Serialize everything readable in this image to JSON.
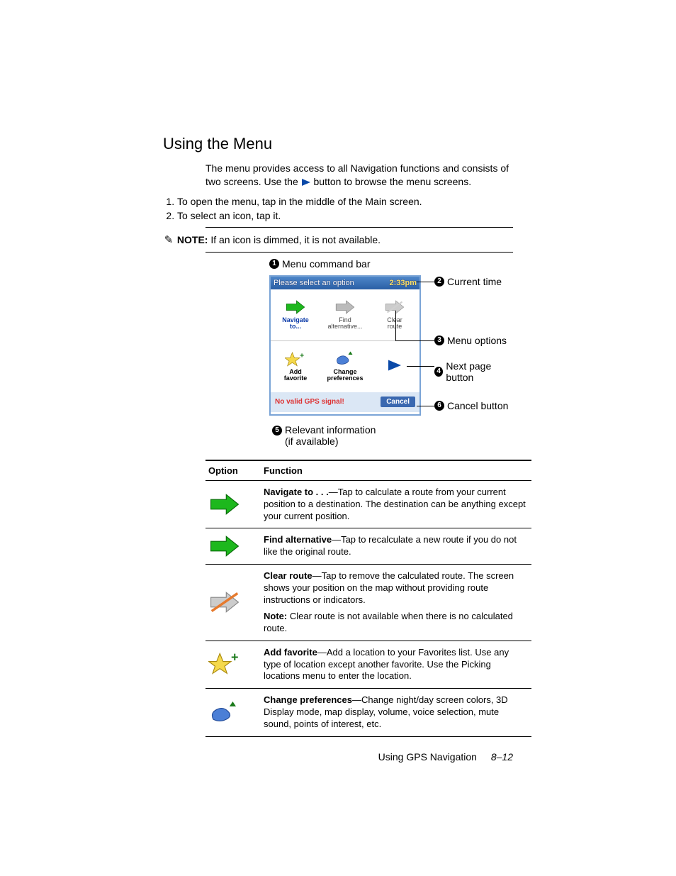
{
  "heading": "Using the Menu",
  "intro_a": "The menu provides access to all Navigation functions and consists of two screens. Use the ",
  "intro_b": " button to browse the menu screens.",
  "steps": [
    "To open the menu, tap in the middle of the Main screen.",
    "To select an icon, tap it."
  ],
  "note_label": "NOTE:",
  "note_text": " If an icon is dimmed, it is not available.",
  "screenshot": {
    "title": "Please select an option",
    "time": "2:33pm",
    "icons": {
      "navigate_to": "Navigate\nto...",
      "find_alt": "Find\nalternative...",
      "clear_route": "Clear\nroute",
      "add_fav": "Add\nfavorite",
      "change_pref": "Change\npreferences"
    },
    "status": "No valid GPS signal!",
    "cancel": "Cancel"
  },
  "callouts": {
    "c1": "Menu command bar",
    "c2": "Current time",
    "c3": "Menu options",
    "c4": "Next page button",
    "c5": "Relevant information\n(if available)",
    "c6": "Cancel button"
  },
  "table": {
    "h_option": "Option",
    "h_function": "Function",
    "rows": [
      {
        "bold": "Navigate to . . .",
        "text": "—Tap to calculate a route from your current position to a destination. The destination can be anything except your current position."
      },
      {
        "bold": "Find alternative",
        "text": "—Tap to recalculate a new route if you do not like the original route."
      },
      {
        "bold": "Clear route",
        "text": "—Tap to remove the calculated route. The screen shows your position on the map without providing route instructions or indicators.",
        "note_bold": "Note:",
        "note_text": " Clear route is not available when there is no calculated route."
      },
      {
        "bold": "Add favorite",
        "text": "—Add a location to your Favorites list. Use any type of location except another favorite. Use the Picking locations menu to enter the location."
      },
      {
        "bold": "Change preferences",
        "text": "—Change night/day screen colors, 3D Display mode, map display, volume, voice selection, mute sound, points of interest, etc."
      }
    ]
  },
  "footer": {
    "chapter": "Using GPS Navigation",
    "page": "8–12"
  }
}
